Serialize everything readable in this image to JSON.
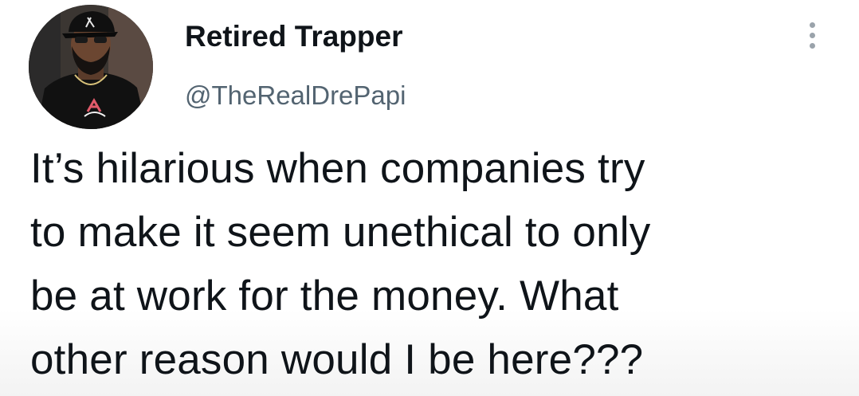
{
  "tweet": {
    "author": {
      "display_name": "Retired Trapper",
      "handle": "@TheRealDrePapi"
    },
    "more_icon": "more-vertical-icon",
    "text_lines": [
      "It’s hilarious when companies try",
      "to make it seem unethical to only",
      "be at work for the money. What",
      "other reason would I be here???"
    ]
  },
  "colors": {
    "text_primary": "#0f1419",
    "text_secondary": "#536471",
    "icon_gray": "#9aa3ab"
  }
}
